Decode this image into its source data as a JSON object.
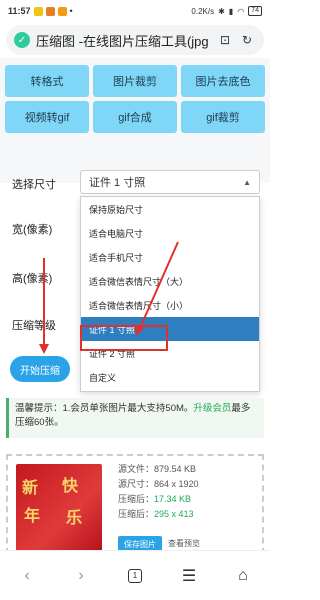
{
  "status": {
    "time": "11:57",
    "speed": "0.2K/s",
    "battery": "74",
    "icon_colors": [
      "#f1c40f",
      "#e67e22",
      "#f39c12"
    ]
  },
  "browser": {
    "page_title": "压缩图 -在线图片压缩工具(jpg",
    "bookmark_icon": "bookmark-icon",
    "refresh_icon": "refresh-icon"
  },
  "tools": [
    "转格式",
    "图片裁剪",
    "图片去底色",
    "视频转gif",
    "gif合成",
    "gif裁剪"
  ],
  "form": {
    "size_label": "选择尺寸",
    "width_label": "宽(像素)",
    "height_label": "高(像素)",
    "level_label": "压缩等级",
    "selected_value": "证件 1 寸照",
    "start_button": "开始压缩"
  },
  "dropdown_options": [
    "保持原始尺寸",
    "适合电脑尺寸",
    "适合手机尺寸",
    "适合微信表情尺寸（大）",
    "适合微信表情尺寸（小）",
    "证件 1 寸照",
    "证件 2 寸照",
    "自定义"
  ],
  "tip": {
    "prefix": "温馨提示：1.会员单张图片最大支持50M。",
    "link": "升级会员",
    "suffix": "最多压缩60张。"
  },
  "result": {
    "source_file_label": "源文件：",
    "source_file_value": "879.54 KB",
    "source_size_label": "源尺寸：",
    "source_size_value": "864 x 1920",
    "compressed_label": "压缩后：",
    "compressed_value": "17.34 KB",
    "compressed_size_label": "压缩后：",
    "compressed_size_value": "295 x 413",
    "save_button": "保存图片",
    "view_link": "查看预览",
    "thumb_text": [
      "新",
      "年",
      "快",
      "乐"
    ]
  },
  "nav": {
    "tab_count": "1"
  },
  "colors": {
    "accent": "#2aa3e8",
    "tool_bg": "#7fd6f7",
    "selected": "#2f7fc0",
    "highlight": "#e03030",
    "link": "#21a857"
  }
}
